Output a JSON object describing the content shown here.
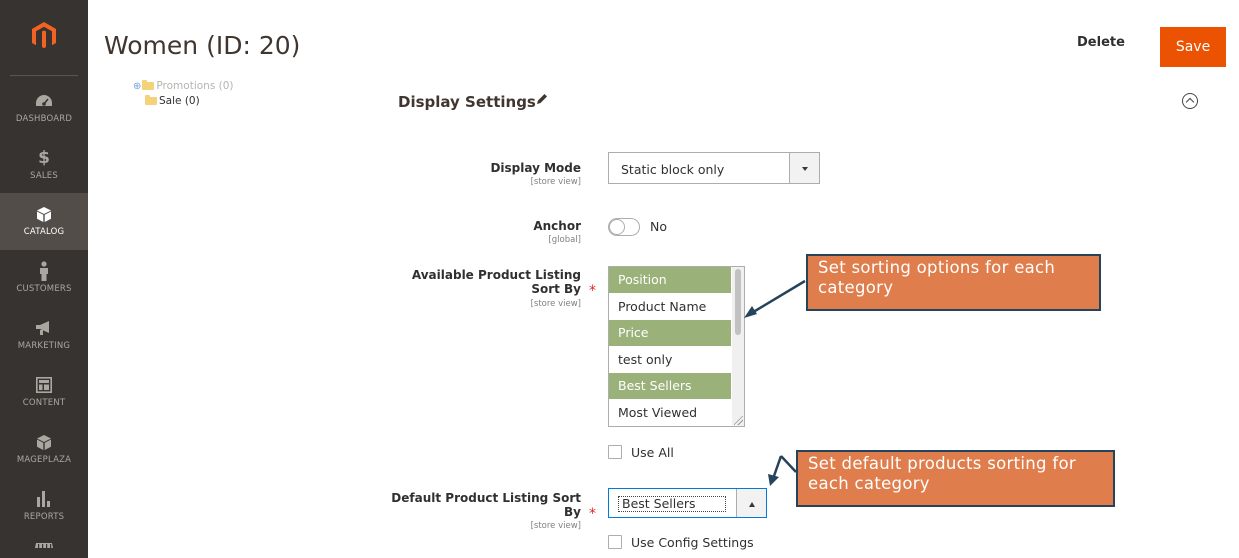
{
  "sidebar": {
    "logo": "magento-logo",
    "items": [
      {
        "label": "DASHBOARD",
        "icon": "dashboard-icon"
      },
      {
        "label": "SALES",
        "icon": "dollar-icon"
      },
      {
        "label": "CATALOG",
        "icon": "cube-icon",
        "active": true
      },
      {
        "label": "CUSTOMERS",
        "icon": "person-icon"
      },
      {
        "label": "MARKETING",
        "icon": "megaphone-icon"
      },
      {
        "label": "CONTENT",
        "icon": "layout-icon"
      },
      {
        "label": "MAGEPLAZA",
        "icon": "cube-icon"
      },
      {
        "label": "REPORTS",
        "icon": "bar-chart-icon"
      },
      {
        "label": "",
        "icon": "store-icon"
      }
    ]
  },
  "header": {
    "title": "Women (ID: 20)",
    "delete_label": "Delete",
    "save_label": "Save"
  },
  "tree": {
    "items": [
      {
        "label": "Promotions (0)"
      },
      {
        "label": "Sale (0)"
      }
    ]
  },
  "section": {
    "title": "Display Settings"
  },
  "form": {
    "display_mode": {
      "label": "Display Mode",
      "scope": "[store view]",
      "value": "Static block only"
    },
    "anchor": {
      "label": "Anchor",
      "scope": "[global]",
      "value": "No"
    },
    "available_sort_by": {
      "label_line1": "Available Product Listing",
      "label_line2": "Sort By",
      "scope": "[store view]",
      "options": [
        {
          "label": "Position",
          "selected": true
        },
        {
          "label": "Product Name",
          "selected": false
        },
        {
          "label": "Price",
          "selected": true
        },
        {
          "label": "test only",
          "selected": false
        },
        {
          "label": "Best Sellers",
          "selected": true
        },
        {
          "label": "Most Viewed",
          "selected": false
        }
      ],
      "use_all_label": "Use All"
    },
    "default_sort_by": {
      "label_line1": "Default Product Listing Sort",
      "label_line2": "By",
      "scope": "[store view]",
      "value": "Best Sellers",
      "use_config_label": "Use Config Settings"
    }
  },
  "callouts": {
    "sorting_options": "Set sorting options for each category",
    "default_sorting": "Set default products sorting for each category"
  },
  "colors": {
    "sidebar_bg": "#373330",
    "save_button": "#eb5202",
    "selected_option": "#9bb17a",
    "callout_bg": "#e07d4c",
    "callout_border": "#26435c",
    "required": "#e22626"
  }
}
